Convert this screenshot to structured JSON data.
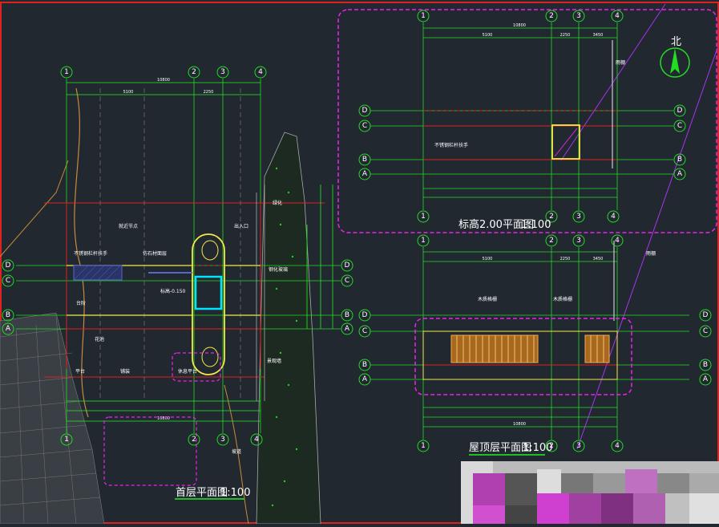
{
  "titles": {
    "floor1": "首层平面图",
    "floor1_scale": "1:100",
    "floor2": "标高2.00平面图",
    "floor2_scale": "1:100",
    "roof": "屋顶层平面图",
    "roof_scale": "1:100",
    "north": "北"
  },
  "axes": {
    "columns": [
      "1",
      "2",
      "3",
      "4"
    ],
    "rows": [
      "D",
      "C",
      "B",
      "A"
    ]
  },
  "dims": {
    "total": "10800",
    "d1": "5100",
    "d2": "2250",
    "d3": "3450"
  },
  "notes": {
    "n1": "就近节点",
    "n2": "出入口",
    "n3": "不锈钢栏杆扶手",
    "n4": "仿石材面层",
    "n5": "钢化玻璃",
    "n6": "台阶",
    "n7": "花池",
    "n8": "平台",
    "n9": "铺装",
    "n10": "景观墙",
    "n11": "坡道",
    "n12": "绿化",
    "n13": "高差处理",
    "n14": "休息平台",
    "n15": "标高-0.150",
    "n16": "雨棚",
    "n17": "木质格栅"
  },
  "colors": {
    "background": "#212830",
    "axis": "#22dd22",
    "grid": "#dd2222",
    "wall": "#f4e94a",
    "highlight": "#ee22ee",
    "dimension": "#22ee22",
    "glass": "#00e5ff"
  },
  "icons": {
    "north_arrow": "north-arrow-icon"
  }
}
